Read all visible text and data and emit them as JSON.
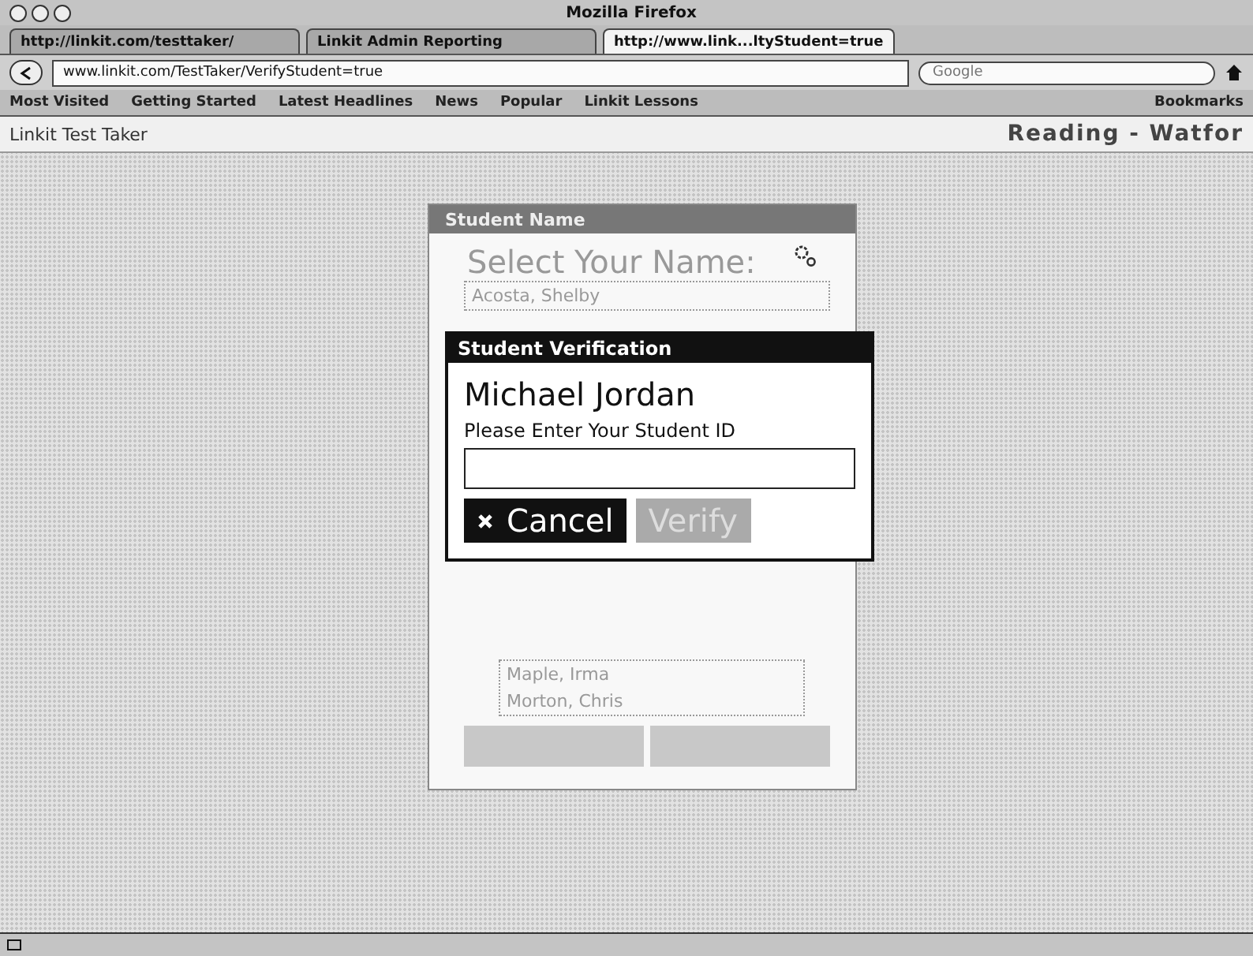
{
  "window": {
    "title": "Mozilla Firefox"
  },
  "tabs": [
    {
      "label": "http://linkit.com/testtaker/",
      "selected": false
    },
    {
      "label": "Linkit Admin Reporting",
      "selected": false
    },
    {
      "label": "http://www.link...ltyStudent=true",
      "selected": true
    }
  ],
  "address_bar": {
    "url": "www.linkit.com/TestTaker/VerifyStudent=true"
  },
  "search": {
    "placeholder": "Google"
  },
  "bookmarks": [
    "Most Visited",
    "Getting Started",
    "Latest Headlines",
    "News",
    "Popular",
    "Linkit Lessons"
  ],
  "bookmarks_menu": "Bookmarks",
  "page": {
    "app_title": "Linkit Test Taker",
    "context": "Reading - Watfor"
  },
  "student_panel": {
    "title": "Student Name",
    "heading": "Select Your Name:",
    "selected_name": "Acosta, Shelby",
    "names": [
      "Maple, Irma",
      "Morton, Chris"
    ]
  },
  "dialog": {
    "title": "Student Verification",
    "student": "Michael Jordan",
    "prompt": "Please Enter Your Student ID",
    "buttons": [
      {
        "label": "Cancel",
        "kind": "cancel",
        "disabled": false
      },
      {
        "label": "Verify",
        "kind": "verify",
        "disabled": true
      }
    ]
  }
}
